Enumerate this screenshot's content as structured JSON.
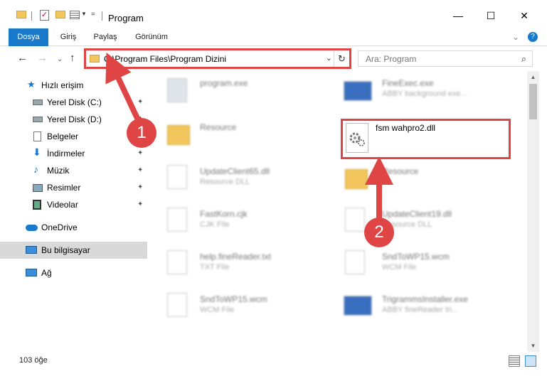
{
  "window": {
    "title": "Program",
    "minimize": "—",
    "maximize": "☐",
    "close": "✕"
  },
  "ribbon": {
    "tabs": [
      "Dosya",
      "Giriş",
      "Paylaş",
      "Görünüm"
    ],
    "expand": "⌄",
    "help": "?"
  },
  "nav": {
    "back": "←",
    "forward": "→",
    "recent": "⌄",
    "up": "↑"
  },
  "address": {
    "path": "C:\\Program Files\\Program Dizini",
    "chevron": "⌄",
    "refresh": "↻"
  },
  "search": {
    "placeholder": "Ara: Program",
    "icon": "⌕"
  },
  "sidebar": {
    "items": [
      {
        "label": "Hızlı erişim",
        "icon": "star-icon"
      },
      {
        "label": "Yerel Disk (C:)",
        "icon": "drive-icon"
      },
      {
        "label": "Yerel Disk (D:)",
        "icon": "drive-icon"
      },
      {
        "label": "Belgeler",
        "icon": "documents-icon"
      },
      {
        "label": "İndirmeler",
        "icon": "download-icon"
      },
      {
        "label": "Müzik",
        "icon": "music-icon"
      },
      {
        "label": "Resimler",
        "icon": "pictures-icon"
      },
      {
        "label": "Videolar",
        "icon": "videos-icon"
      },
      {
        "label": "OneDrive",
        "icon": "cloud-icon"
      },
      {
        "label": "Bu bilgisayar",
        "icon": "computer-icon"
      },
      {
        "label": "Ağ",
        "icon": "network-icon"
      }
    ],
    "pin": "✦"
  },
  "files": {
    "left": [
      {
        "name": "program.exe",
        "sub": ""
      },
      {
        "name": "Resource",
        "sub": ""
      },
      {
        "name": "UpdateClient65.dll",
        "sub": "Resource DLL"
      },
      {
        "name": "FastKorn.cjk",
        "sub": "CJK File"
      },
      {
        "name": "help.fineReader.txt",
        "sub": "TXT File"
      },
      {
        "name": "SndToWP15.wcm",
        "sub": "WCM File"
      }
    ],
    "right": [
      {
        "name": "FineExec.exe",
        "sub": "ABBY background exe..."
      },
      {
        "name": "Resource",
        "sub": ""
      },
      {
        "name": "UpdateClient19.dll",
        "sub": "Resource DLL"
      },
      {
        "name": "SndToWP15.wcm",
        "sub": "WCM File"
      },
      {
        "name": "TrigrammsInstaller.exe",
        "sub": "ABBY fineReader tri..."
      }
    ],
    "highlighted": {
      "name": "fsm wahpro2.dll"
    }
  },
  "status": {
    "count": "103 öğe"
  },
  "annotations": {
    "badge1": "1",
    "badge2": "2",
    "color": "#e04545"
  },
  "colors": {
    "accent": "#1979ca",
    "folder": "#f2c65c",
    "selected": "#d9d9d9"
  }
}
